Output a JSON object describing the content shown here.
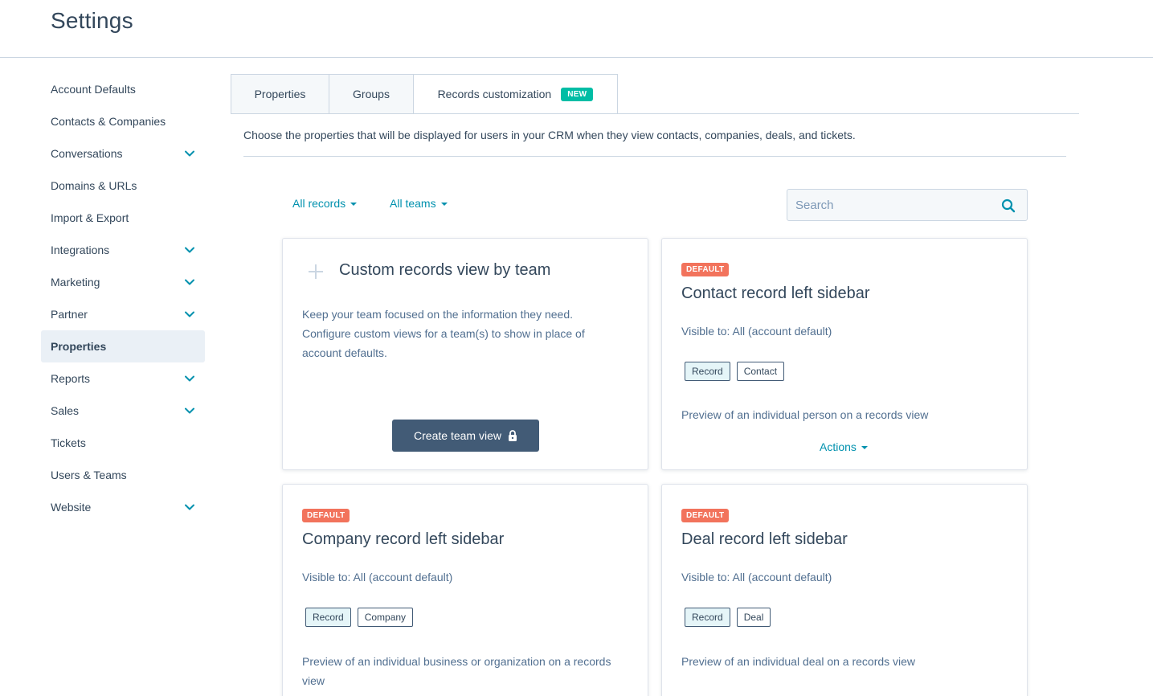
{
  "header": {
    "title": "Settings"
  },
  "sidebar": {
    "items": [
      {
        "label": "Account Defaults",
        "expandable": false,
        "active": false
      },
      {
        "label": "Contacts & Companies",
        "expandable": false,
        "active": false
      },
      {
        "label": "Conversations",
        "expandable": true,
        "active": false
      },
      {
        "label": "Domains & URLs",
        "expandable": false,
        "active": false
      },
      {
        "label": "Import & Export",
        "expandable": false,
        "active": false
      },
      {
        "label": "Integrations",
        "expandable": true,
        "active": false
      },
      {
        "label": "Marketing",
        "expandable": true,
        "active": false
      },
      {
        "label": "Partner",
        "expandable": true,
        "active": false
      },
      {
        "label": "Properties",
        "expandable": false,
        "active": true
      },
      {
        "label": "Reports",
        "expandable": true,
        "active": false
      },
      {
        "label": "Sales",
        "expandable": true,
        "active": false
      },
      {
        "label": "Tickets",
        "expandable": false,
        "active": false
      },
      {
        "label": "Users & Teams",
        "expandable": false,
        "active": false
      },
      {
        "label": "Website",
        "expandable": true,
        "active": false
      }
    ]
  },
  "tabs": [
    {
      "label": "Properties"
    },
    {
      "label": "Groups"
    },
    {
      "label": "Records customization",
      "badge": "NEW",
      "active": true
    }
  ],
  "description": "Choose the properties that will be displayed for users in your CRM when they view contacts, companies, deals, and tickets.",
  "filters": {
    "records": "All records",
    "teams": "All teams"
  },
  "search": {
    "placeholder": "Search",
    "value": ""
  },
  "custom_card": {
    "title": "Custom records view by team",
    "description": "Keep your team focused on the information they need. Configure custom views for a team(s) to show in place of account defaults.",
    "button_label": "Create team view"
  },
  "cards": [
    {
      "badge": "DEFAULT",
      "title": "Contact record left sidebar",
      "visible": "Visible to: All (account default)",
      "chips": [
        "Record",
        "Contact"
      ],
      "preview": "Preview of an individual person on a records view",
      "actions_label": "Actions"
    },
    {
      "badge": "DEFAULT",
      "title": "Company record left sidebar",
      "visible": "Visible to: All (account default)",
      "chips": [
        "Record",
        "Company"
      ],
      "preview": "Preview of an individual business or organization on a records view"
    },
    {
      "badge": "DEFAULT",
      "title": "Deal record left sidebar",
      "visible": "Visible to: All (account default)",
      "chips": [
        "Record",
        "Deal"
      ],
      "preview": "Preview of an individual deal on a records view"
    }
  ],
  "colors": {
    "accent": "#0091ae",
    "new_badge": "#00bda5",
    "default_badge": "#f2735c",
    "button": "#425b76",
    "text": "#33475b"
  }
}
